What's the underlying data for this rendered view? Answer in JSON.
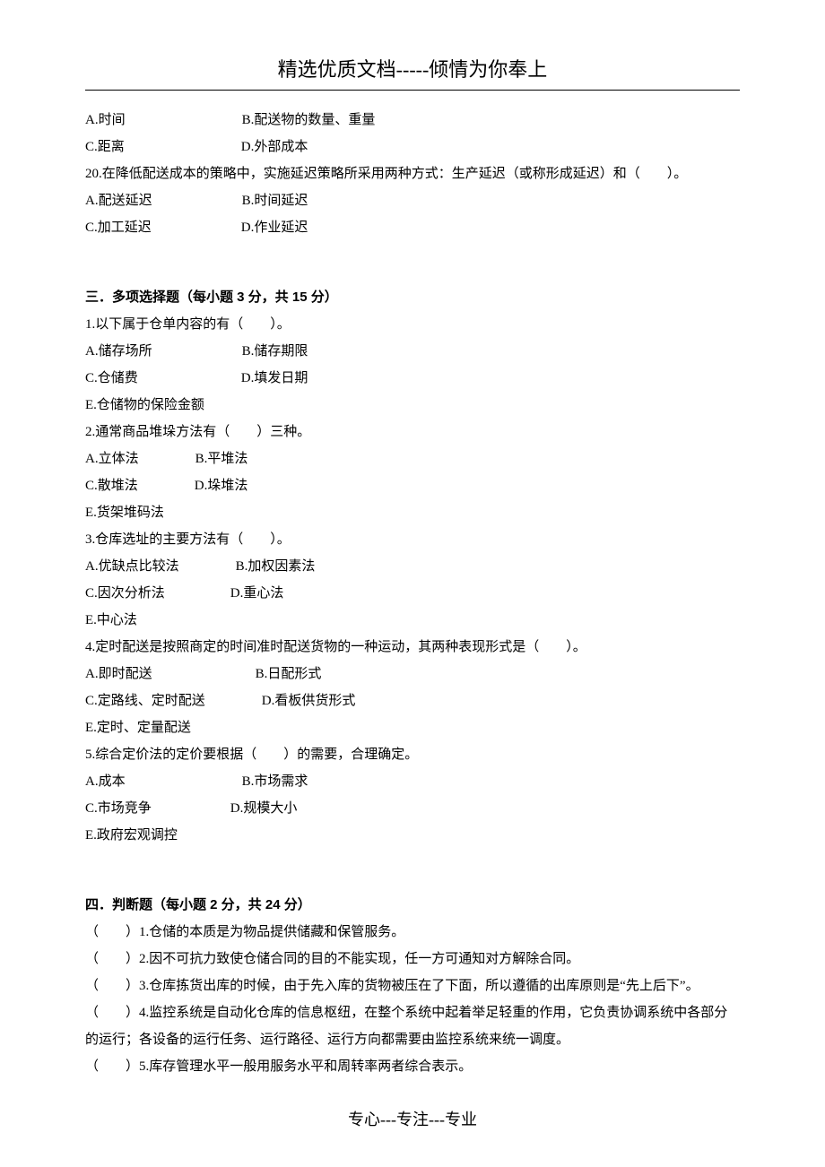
{
  "header": "精选优质文档-----倾情为你奉上",
  "footer": "专心---专注---专业",
  "s2_q19": {
    "opts": {
      "a": "A.时间",
      "b": "B.配送物的数量、重量",
      "c": "C.距离",
      "d": "D.外部成本"
    }
  },
  "s2_q20": {
    "text": "20.在降低配送成本的策略中，实施延迟策略所采用两种方式：生产延迟（或称形成延迟）和（　　）。",
    "opts": {
      "a": "A.配送延迟",
      "b": "B.时间延迟",
      "c": "C.加工延迟",
      "d": "D.作业延迟"
    }
  },
  "section3": {
    "title": "三．多项选择题（每小题 3 分，共 15 分）"
  },
  "s3_q1": {
    "text": "1.以下属于仓单内容的有（　　）。",
    "opts": {
      "a": "A.储存场所",
      "b": "B.储存期限",
      "c": "C.仓储费",
      "d": "D.填发日期",
      "e": "E.仓储物的保险金额"
    }
  },
  "s3_q2": {
    "text": "2.通常商品堆垛方法有（　　）三种。",
    "opts": {
      "a": "A.立体法",
      "b": "B.平堆法",
      "c": "C.散堆法",
      "d": "D.垛堆法",
      "e": "E.货架堆码法"
    }
  },
  "s3_q3": {
    "text": "3.仓库选址的主要方法有（　　）。",
    "opts": {
      "a": "A.优缺点比较法",
      "b": "B.加权因素法",
      "c": "C.因次分析法",
      "d": "D.重心法",
      "e": "E.中心法"
    }
  },
  "s3_q4": {
    "text": "4.定时配送是按照商定的时间准时配送货物的一种运动，其两种表现形式是（　　）。",
    "opts": {
      "a": "A.即时配送",
      "b": "B.日配形式",
      "c": "C.定路线、定时配送",
      "d": "D.看板供货形式",
      "e": "E.定时、定量配送"
    }
  },
  "s3_q5": {
    "text": "5.综合定价法的定价要根据（　　）的需要，合理确定。",
    "opts": {
      "a": "A.成本",
      "b": "B.市场需求",
      "c": "C.市场竞争",
      "d": "D.规模大小",
      "e": "E.政府宏观调控"
    }
  },
  "section4": {
    "title": "四．判断题（每小题 2 分，共 24 分）"
  },
  "s4": {
    "q1": "（　　）1.仓储的本质是为物品提供储藏和保管服务。",
    "q2": "（　　）2.因不可抗力致使仓储合同的目的不能实现，任一方可通知对方解除合同。",
    "q3": "（　　）3.仓库拣货出库的时候，由于先入库的货物被压在了下面，所以遵循的出库原则是“先上后下”。",
    "q4": "（　　）4.监控系统是自动化仓库的信息枢纽，在整个系统中起着举足轻重的作用，它负责协调系统中各部分的运行；各设备的运行任务、运行路径、运行方向都需要由监控系统来统一调度。",
    "q5": "（　　）5.库存管理水平一般用服务水平和周转率两者综合表示。"
  }
}
